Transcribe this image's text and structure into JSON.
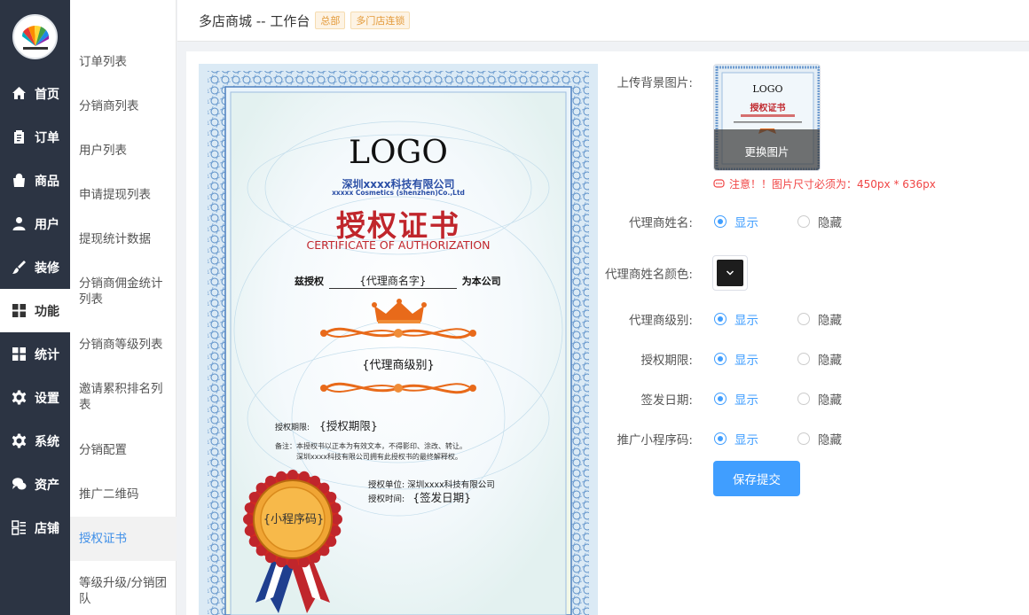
{
  "header": {
    "title": "多店商城 -- 工作台",
    "badges": [
      "总部",
      "多门店连锁"
    ]
  },
  "nav": {
    "items": [
      {
        "label": "首页",
        "icon": "home-icon"
      },
      {
        "label": "订单",
        "icon": "clipboard-icon"
      },
      {
        "label": "商品",
        "icon": "shopping-bag-icon"
      },
      {
        "label": "用户",
        "icon": "user-icon"
      },
      {
        "label": "装修",
        "icon": "paint-brush-icon"
      },
      {
        "label": "功能",
        "icon": "grid-icon"
      },
      {
        "label": "统计",
        "icon": "chart-grid-icon"
      },
      {
        "label": "设置",
        "icon": "gear-icon"
      },
      {
        "label": "系统",
        "icon": "cog-icon"
      },
      {
        "label": "资产",
        "icon": "chat-icon"
      },
      {
        "label": "店铺",
        "icon": "store-icon"
      }
    ],
    "active": "功能"
  },
  "submenu": {
    "items": [
      "订单列表",
      "分销商列表",
      "用户列表",
      "申请提现列表",
      "提现统计数据",
      "分销商佣金统计列表",
      "分销商等级列表",
      "邀请累积排名列表",
      "分销配置",
      "推广二维码",
      "授权证书",
      "等级升级/分销团队"
    ],
    "active": "授权证书"
  },
  "cert": {
    "logo": "LOGO",
    "company_cn": "深圳xxxx科技有限公司",
    "company_en": "xxxxx Cosmetics (shenzhen)Co.,Ltd",
    "title_cn": "授权证书",
    "title_en": "CERTIFICATE OF AUTHORIZATION",
    "grant_prefix": "兹授权",
    "agent_name": "{代理商名字}",
    "grant_suffix": "为本公司",
    "agent_level": "{代理商级别}",
    "period_label": "授权期限:",
    "period_value": "{授权期限}",
    "note_line1": "备注：本授权书以正本为有效文本，不得影印、涂改、转让。",
    "note_line2": "深圳xxxx科技有限公司拥有此授权书的最终解释权。",
    "unit_label": "授权单位:",
    "unit_value": "深圳xxxx科技有限公司",
    "time_label": "授权时间:",
    "time_value": "{签发日期}",
    "seal_text": "{小程序码}",
    "thumb_logo": "LOGO",
    "thumb_title": "授权证书"
  },
  "form": {
    "bg_label": "上传背景图片:",
    "change_image": "更换图片",
    "warning": "注意！！图片尺寸必须为：450px * 636px",
    "show": "显示",
    "hide": "隐藏",
    "fields": [
      {
        "label": "代理商姓名:",
        "value": "显示"
      },
      {
        "label": "代理商级别:",
        "value": "显示"
      },
      {
        "label": "授权期限:",
        "value": "显示"
      },
      {
        "label": "签发日期:",
        "value": "显示"
      },
      {
        "label": "推广小程序码:",
        "value": "显示"
      }
    ],
    "color_label": "代理商姓名颜色:",
    "color_value": "#1d1d1d",
    "submit": "保存提交"
  },
  "colors": {
    "accent": "#409eff",
    "sidebar": "#2c3443",
    "cert_red": "#c0262c",
    "cert_blue": "#2b4fa6",
    "ornament": "#e86a1a"
  }
}
